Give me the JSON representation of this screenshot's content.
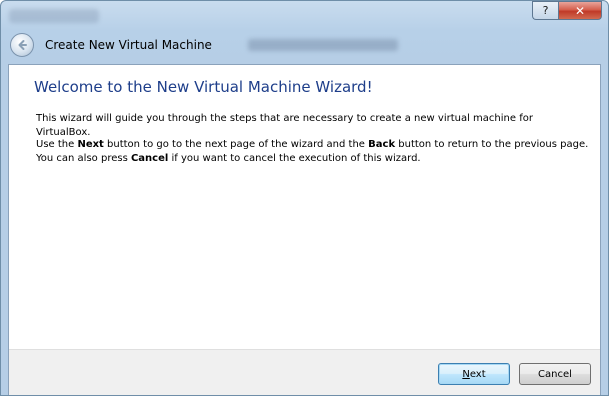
{
  "window": {
    "title": "",
    "help_label": "?",
    "close_label": "✕"
  },
  "header": {
    "back_icon": "back-arrow-icon",
    "title": "Create New Virtual Machine"
  },
  "page": {
    "title": "Welcome to the New Virtual Machine Wizard!",
    "intro": "This wizard will guide you through the steps that are necessary to create a new virtual machine for VirtualBox.",
    "p2_part1": "Use the ",
    "p2_next": "Next",
    "p2_part2": " button to go to the next page of the wizard and the ",
    "p2_back": "Back",
    "p2_part3": " button to return to the previous page. You can also press ",
    "p2_cancel": "Cancel",
    "p2_part4": " if you want to cancel the execution of this wizard."
  },
  "footer": {
    "next_first": "N",
    "next_rest": "ext",
    "cancel_label": "Cancel"
  }
}
